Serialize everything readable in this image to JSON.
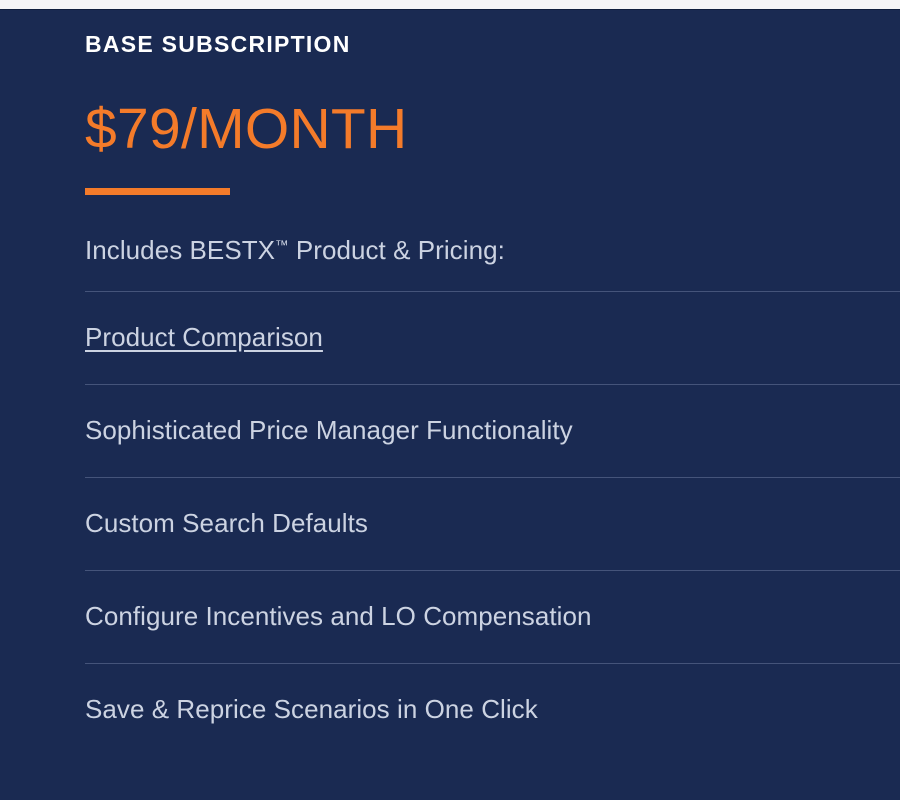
{
  "theme": {
    "background_navy": "#1a2a52",
    "accent_orange": "#f47b2a",
    "body_text": "#ccd3e2",
    "heading_text": "#ffffff",
    "divider": "#45547a",
    "top_strip": "#f4f4f6"
  },
  "panel": {
    "eyebrow": "BASE SUBSCRIPTION",
    "price": "$79/MONTH",
    "includes_prefix": "Includes BESTX",
    "includes_trademark": "™",
    "includes_suffix": " Product & Pricing:",
    "features": [
      {
        "label": "Product Comparison",
        "type": "link"
      },
      {
        "label": "Sophisticated Price Manager Functionality",
        "type": "text"
      },
      {
        "label": "Custom Search Defaults",
        "type": "text"
      },
      {
        "label": "Configure Incentives and LO Compensation",
        "type": "text"
      },
      {
        "label": "Save & Reprice Scenarios in One Click",
        "type": "text"
      }
    ]
  }
}
